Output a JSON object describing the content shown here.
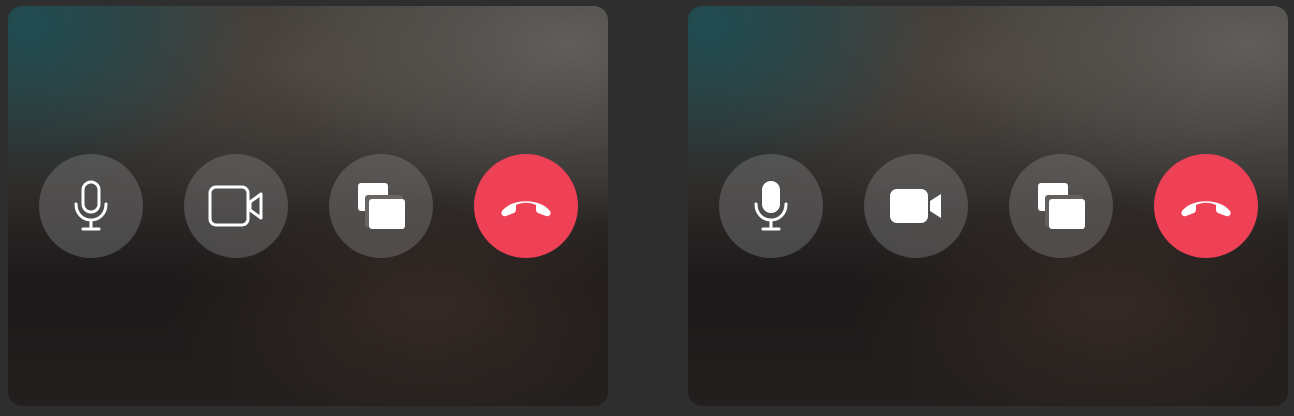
{
  "panels": [
    {
      "id": "left",
      "style": "outline",
      "buttons": [
        {
          "name": "microphone-button",
          "icon": "microphone-outline-icon"
        },
        {
          "name": "camera-button",
          "icon": "video-camera-outline-icon"
        },
        {
          "name": "screen-share-button",
          "icon": "overlapping-windows-icon"
        },
        {
          "name": "end-call-button",
          "icon": "phone-hangup-icon"
        }
      ]
    },
    {
      "id": "right",
      "style": "filled",
      "buttons": [
        {
          "name": "microphone-button",
          "icon": "microphone-filled-icon"
        },
        {
          "name": "camera-button",
          "icon": "video-camera-filled-icon"
        },
        {
          "name": "screen-share-button",
          "icon": "overlapping-windows-icon"
        },
        {
          "name": "end-call-button",
          "icon": "phone-hangup-icon"
        }
      ]
    }
  ],
  "colors": {
    "background": "#2e2e2e",
    "button": "#6b6b6b",
    "hangup": "#ee4155",
    "icon": "#ffffff"
  }
}
